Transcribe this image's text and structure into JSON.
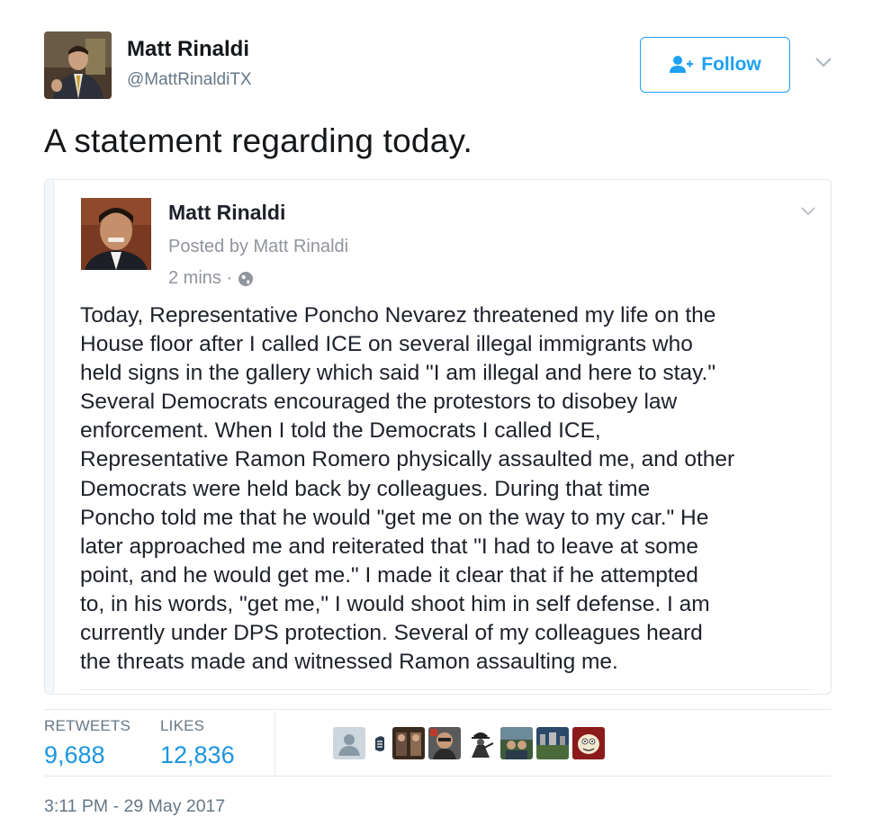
{
  "tweet": {
    "author_name": "Matt Rinaldi",
    "author_handle": "@MattRinaldiTX",
    "follow_label": "Follow",
    "text": "A statement regarding today.",
    "timestamp": "3:11 PM - 29 May 2017"
  },
  "embedded_post": {
    "name": "Matt Rinaldi",
    "posted_by": "Posted by Matt Rinaldi",
    "time": "2 mins · ",
    "body_lines": [
      "Today, Representative Poncho Nevarez threatened my life on the",
      "House floor after I called ICE on several illegal immigrants who",
      "held signs in the gallery which said \"I am illegal and here to stay.\"",
      "Several Democrats encouraged the protestors to disobey law",
      "enforcement. When I told the Democrats I called ICE,",
      "Representative Ramon Romero physically assaulted me, and other",
      "Democrats were held back by colleagues. During that time",
      "Poncho told me that he would \"get me on the way to my car.\" He",
      "later approached me and reiterated that \"I had to leave at some",
      "point, and he would get me.\" I made it clear that if he attempted",
      "to, in his words, \"get me,\" I would shoot him in self defense. I am",
      "currently under DPS protection. Several of my colleagues heard",
      "the threats made and witnessed Ramon assaulting me."
    ]
  },
  "stats": {
    "retweets_label": "RETWEETS",
    "retweets_value": "9,688",
    "likes_label": "LIKES",
    "likes_value": "12,836"
  },
  "colors": {
    "accent": "#1da1f2",
    "stat_value": "#1b95e0",
    "muted": "#657786",
    "border": "#e1e8ed"
  },
  "icons": [
    "follow-person-icon",
    "chevron-down-icon",
    "globe-icon",
    "default-avatar-icon"
  ]
}
